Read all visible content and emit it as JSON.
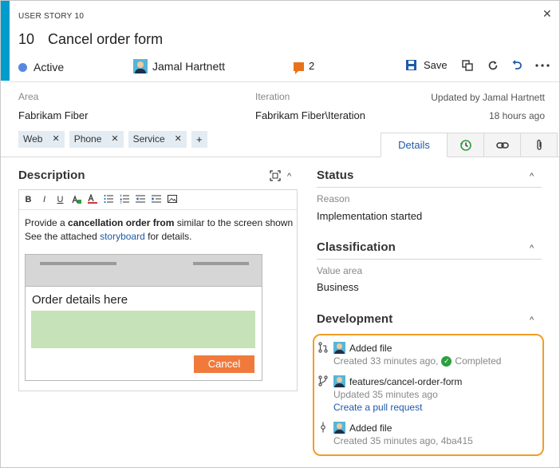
{
  "header": {
    "type_label": "USER STORY 10",
    "id": "10",
    "title": "Cancel order form",
    "state": "Active",
    "assignee": "Jamal Hartnett",
    "comment_count": "2",
    "save_label": "Save"
  },
  "meta": {
    "area_label": "Area",
    "area_value": "Fabrikam Fiber",
    "iteration_label": "Iteration",
    "iteration_value": "Fabrikam Fiber\\Iteration",
    "updated_by": "Updated by Jamal Hartnett",
    "updated_ago": "18 hours ago"
  },
  "tags": [
    "Web",
    "Phone",
    "Service"
  ],
  "tag_add": "+",
  "tabs": {
    "details": "Details"
  },
  "description": {
    "title": "Description",
    "text_pre": "Provide a ",
    "text_bold": "cancellation order from",
    "text_post": " similar to the screen shown",
    "line2_pre": "See the attached ",
    "line2_link": "storyboard",
    "line2_post": " for details.",
    "mock_heading": "Order details here",
    "mock_cancel": "Cancel",
    "format_buttons": [
      "B",
      "I",
      "U"
    ]
  },
  "status": {
    "title": "Status",
    "reason_label": "Reason",
    "reason_value": "Implementation started"
  },
  "classification": {
    "title": "Classification",
    "value_area_label": "Value area",
    "value_area_value": "Business"
  },
  "development": {
    "title": "Development",
    "items": [
      {
        "title": "Added file",
        "sub": "Created 33 minutes ago,",
        "status": "Completed"
      },
      {
        "title": "features/cancel-order-form",
        "sub": "Updated 35 minutes ago",
        "link": "Create a pull request"
      },
      {
        "title": "Added file",
        "sub": "Created 35 minutes ago, 4ba415"
      }
    ]
  },
  "colors": {
    "accent": "#009ccc",
    "active_state": "#5688e0",
    "comment": "#e8731c",
    "highlight_border": "#f39d26",
    "cancel_button": "#f07a3c",
    "completed": "#2a9f3d"
  }
}
